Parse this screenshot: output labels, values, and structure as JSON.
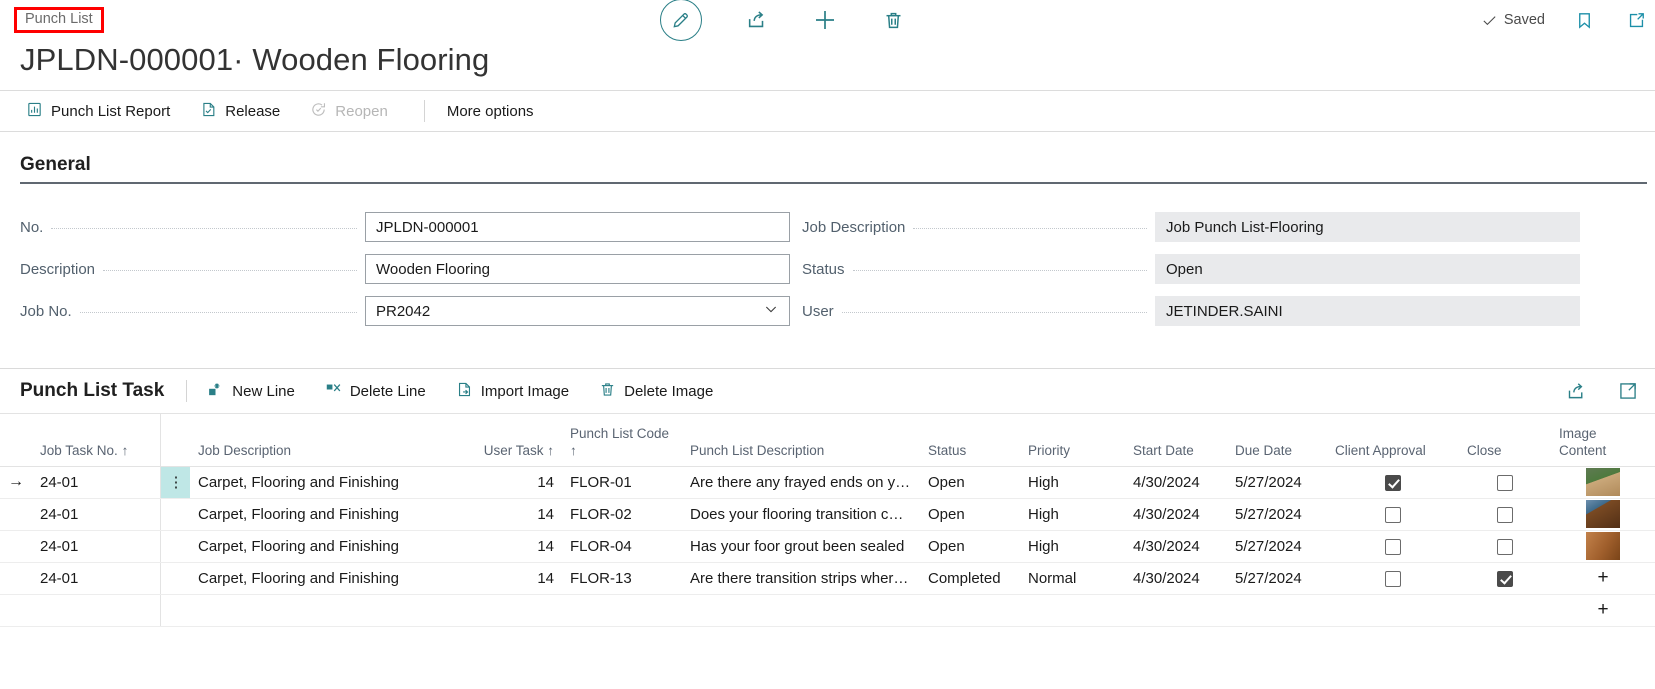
{
  "breadcrumb": "Punch List",
  "title": {
    "no": "JPLDN-000001",
    "separator": "·",
    "name": "Wooden Flooring"
  },
  "topbar": {
    "edit_icon": "pencil-icon",
    "share_icon": "share-icon",
    "new_icon": "plus-icon",
    "delete_icon": "trash-icon",
    "saved_label": "Saved",
    "bookmark_icon": "bookmark-icon",
    "open_new_window_icon": "open-in-new-window-icon"
  },
  "ribbon": {
    "items": [
      {
        "label": "Punch List Report",
        "icon": "report-icon",
        "disabled": false
      },
      {
        "label": "Release",
        "icon": "release-document-icon",
        "disabled": false
      },
      {
        "label": "Reopen",
        "icon": "reopen-icon",
        "disabled": true
      }
    ],
    "more_options": "More options"
  },
  "general": {
    "heading": "General",
    "left_fields": [
      {
        "label": "No.",
        "value": "JPLDN-000001",
        "type": "editable"
      },
      {
        "label": "Description",
        "value": "Wooden Flooring",
        "type": "editable"
      },
      {
        "label": "Job No.",
        "value": "PR2042",
        "type": "dropdown"
      }
    ],
    "right_fields": [
      {
        "label": "Job Description",
        "value": "Job Punch List-Flooring",
        "type": "readonly"
      },
      {
        "label": "Status",
        "value": "Open",
        "type": "readonly"
      },
      {
        "label": "User",
        "value": "JETINDER.SAINI",
        "type": "readonly"
      }
    ]
  },
  "part": {
    "title": "Punch List Task",
    "actions": [
      {
        "label": "New Line",
        "icon": "new-line-icon"
      },
      {
        "label": "Delete Line",
        "icon": "delete-line-icon"
      },
      {
        "label": "Import Image",
        "icon": "import-image-icon"
      },
      {
        "label": "Delete Image",
        "icon": "delete-image-icon"
      }
    ],
    "right_icons": [
      {
        "icon": "share-icon"
      },
      {
        "icon": "open-in-new-window-icon"
      }
    ]
  },
  "grid": {
    "columns": [
      {
        "key": "indicator",
        "label": ""
      },
      {
        "key": "job_task_no",
        "label": "Job Task No.",
        "sort": "↑"
      },
      {
        "key": "rowmenu",
        "label": ""
      },
      {
        "key": "job_description",
        "label": "Job Description"
      },
      {
        "key": "user_task",
        "label": "User Task",
        "sort": "↑",
        "align": "right"
      },
      {
        "key": "punch_list_code",
        "label": "Punch List Code",
        "sort": "↑"
      },
      {
        "key": "punch_list_description",
        "label": "Punch List Description"
      },
      {
        "key": "status",
        "label": "Status"
      },
      {
        "key": "priority",
        "label": "Priority"
      },
      {
        "key": "start_date",
        "label": "Start Date"
      },
      {
        "key": "due_date",
        "label": "Due Date"
      },
      {
        "key": "client_approval",
        "label": "Client Approval",
        "align": "center"
      },
      {
        "key": "close",
        "label": "Close",
        "align": "center"
      },
      {
        "key": "image_content",
        "label": "Image Content"
      }
    ],
    "rows": [
      {
        "selected": true,
        "job_task_no": "24-01",
        "job_description": "Carpet, Flooring and Finishing",
        "user_task": "14",
        "punch_list_code": "FLOR-01",
        "punch_list_description": "Are there any frayed ends on y…",
        "status": "Open",
        "priority": "High",
        "start_date": "4/30/2024",
        "due_date": "5/27/2024",
        "client_approval": true,
        "close": false,
        "image": "photo-thumbnail-1"
      },
      {
        "selected": false,
        "job_task_no": "24-01",
        "job_description": "Carpet, Flooring and Finishing",
        "user_task": "14",
        "punch_list_code": "FLOR-02",
        "punch_list_description": "Does your flooring transition c…",
        "status": "Open",
        "priority": "High",
        "start_date": "4/30/2024",
        "due_date": "5/27/2024",
        "client_approval": false,
        "close": false,
        "image": "photo-thumbnail-2"
      },
      {
        "selected": false,
        "job_task_no": "24-01",
        "job_description": "Carpet, Flooring and Finishing",
        "user_task": "14",
        "punch_list_code": "FLOR-04",
        "punch_list_description": "Has your foor grout been sealed",
        "status": "Open",
        "priority": "High",
        "start_date": "4/30/2024",
        "due_date": "5/27/2024",
        "client_approval": false,
        "close": false,
        "image": "photo-thumbnail-3"
      },
      {
        "selected": false,
        "job_task_no": "24-01",
        "job_description": "Carpet, Flooring and Finishing",
        "user_task": "14",
        "punch_list_code": "FLOR-13",
        "punch_list_description": "Are there transition strips wher…",
        "status": "Completed",
        "priority": "Normal",
        "start_date": "4/30/2024",
        "due_date": "5/27/2024",
        "client_approval": false,
        "close": true,
        "image": "add-image-plus"
      }
    ],
    "row_menu_glyph": "⋮",
    "selected_arrow": "→",
    "add_image_glyph": "+"
  },
  "colors": {
    "accent_teal": "#2a7f87",
    "selection_highlight": "#bfe7e6",
    "breadcrumb_outline": "#ff0000",
    "readonly_bg": "#e9eaec"
  }
}
